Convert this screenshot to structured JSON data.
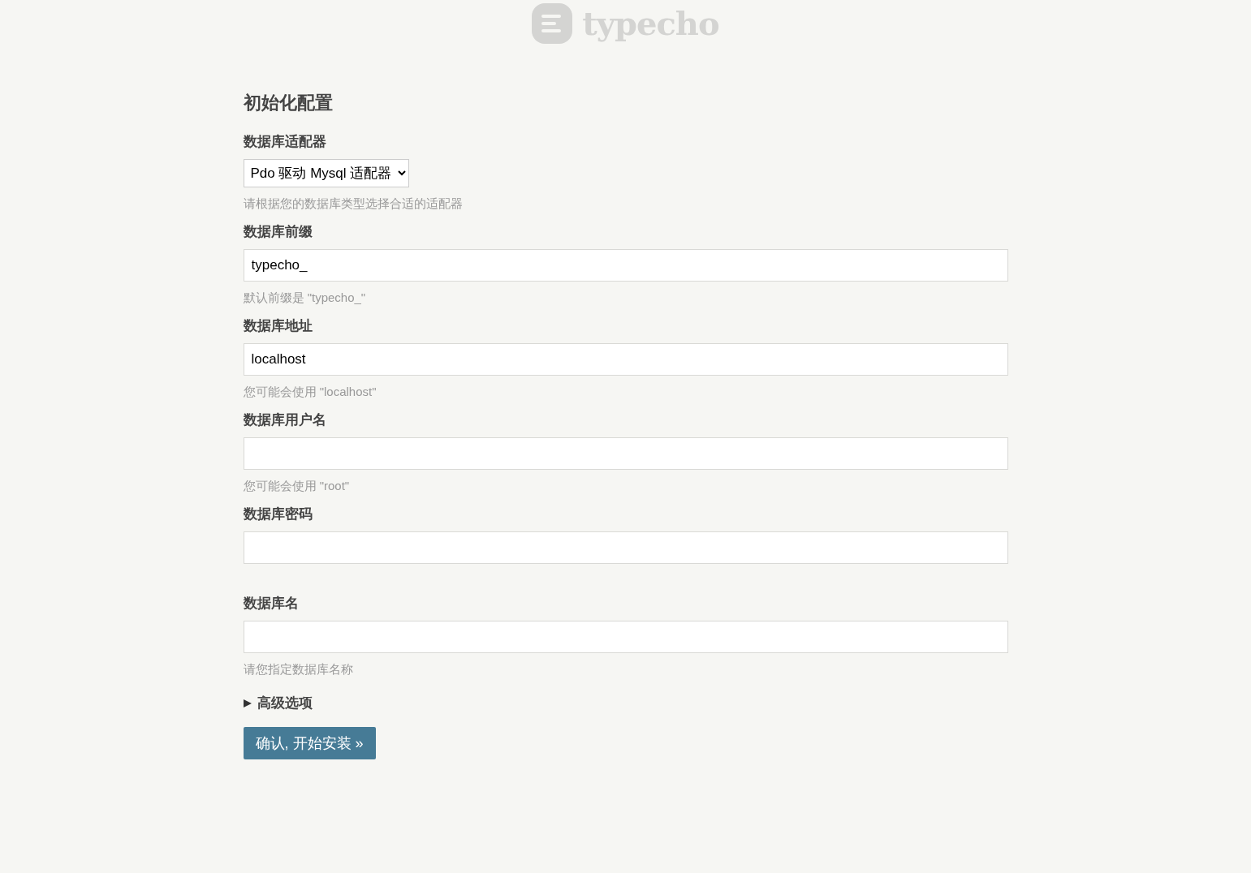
{
  "logo": {
    "text": "typecho"
  },
  "heading": "初始化配置",
  "fields": [
    {
      "kind": "select",
      "label": "数据库适配器",
      "value": "Pdo 驱动 Mysql 适配器",
      "hint": "请根据您的数据库类型选择合适的适配器"
    },
    {
      "kind": "input",
      "label": "数据库前缀",
      "value": "typecho_",
      "hint": "默认前缀是 \"typecho_\""
    },
    {
      "kind": "input",
      "label": "数据库地址",
      "value": "localhost",
      "hint": "您可能会使用 \"localhost\""
    },
    {
      "kind": "input",
      "label": "数据库用户名",
      "hint": "您可能会使用 \"root\""
    },
    {
      "kind": "input",
      "label": "数据库密码"
    },
    {
      "kind": "input",
      "label": "数据库名",
      "hint": "请您指定数据库名称"
    }
  ],
  "advanced": {
    "label": "高级选项",
    "expanded": false
  },
  "submit": "确认, 开始安装 »"
}
